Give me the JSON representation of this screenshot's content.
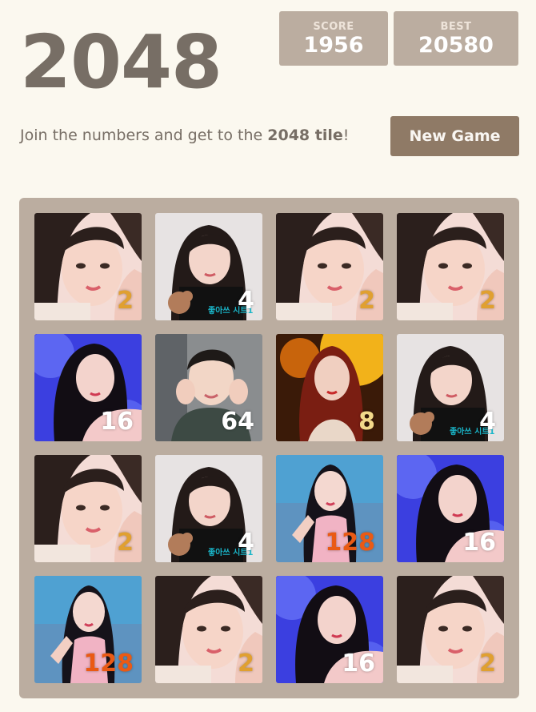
{
  "header": {
    "title": "2048",
    "score_label": "SCORE",
    "score_value": "1956",
    "best_label": "BEST",
    "best_value": "20580"
  },
  "intro": {
    "prefix": "Join the numbers and get to the ",
    "emphasis": "2048 tile",
    "suffix": "!"
  },
  "controls": {
    "new_game_label": "New Game"
  },
  "board": {
    "rows": [
      [
        {
          "value": "2",
          "photo": "selfie-peace-pink"
        },
        {
          "value": "4",
          "photo": "bear-black-dress",
          "caption": "좋아쓰 시트1"
        },
        {
          "value": "2",
          "photo": "selfie-peace-pink"
        },
        {
          "value": "2",
          "photo": "selfie-peace-pink"
        }
      ],
      [
        {
          "value": "16",
          "photo": "blue-stage-pose"
        },
        {
          "value": "64",
          "photo": "hands-face-green"
        },
        {
          "value": "8",
          "photo": "gold-stage-red-hair"
        },
        {
          "value": "4",
          "photo": "bear-black-dress",
          "caption": "좋아쓰 시트1"
        }
      ],
      [
        {
          "value": "2",
          "photo": "selfie-peace-pink"
        },
        {
          "value": "4",
          "photo": "bear-black-dress",
          "caption": "좋아쓰 시트1"
        },
        {
          "value": "128",
          "photo": "teal-stage-pointing"
        },
        {
          "value": "16",
          "photo": "blue-stage-pose"
        }
      ],
      [
        {
          "value": "128",
          "photo": "teal-stage-pointing"
        },
        {
          "value": "2",
          "photo": "selfie-peace-pink"
        },
        {
          "value": "16",
          "photo": "blue-stage-pose"
        },
        {
          "value": "2",
          "photo": "selfie-peace-pink"
        }
      ]
    ]
  },
  "colors": {
    "background": "#fbf8ef",
    "board": "#bbada0",
    "button": "#8f7a66",
    "text": "#776e65"
  }
}
